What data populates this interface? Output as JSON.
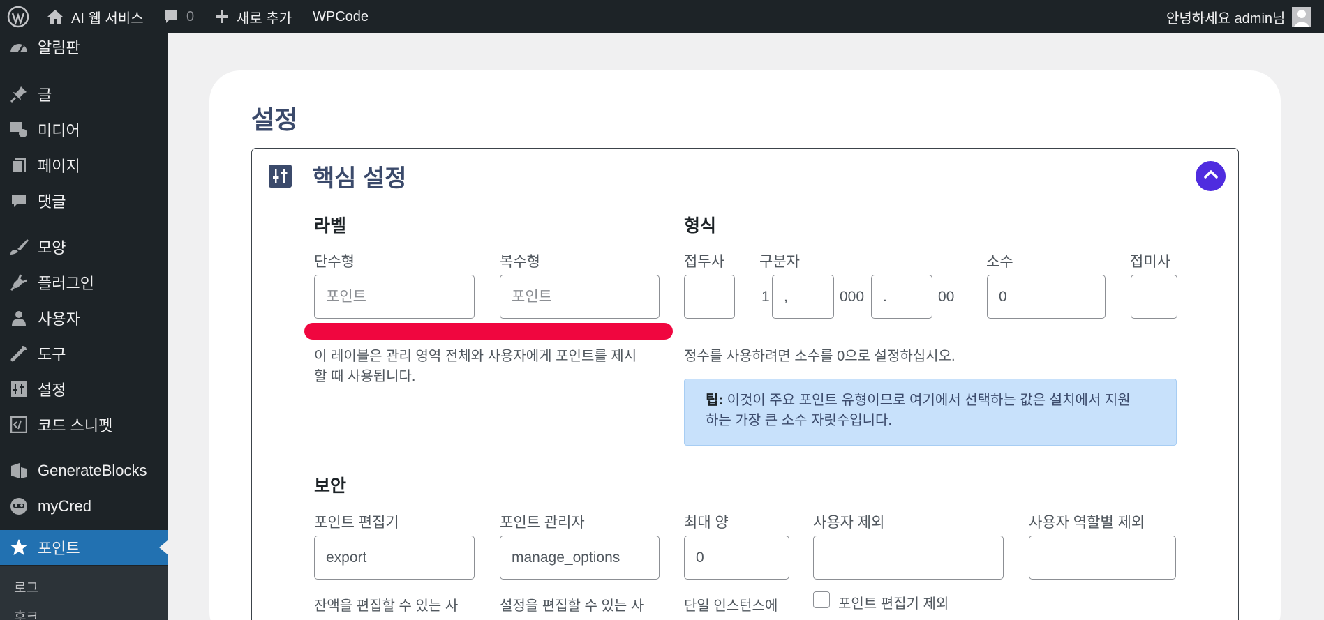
{
  "admin_bar": {
    "site_name": "AI 웹 서비스",
    "comments_count": "0",
    "new_label": "새로 추가",
    "plugin_link": "WPCode",
    "greeting": "안녕하세요 admin님"
  },
  "sidebar": {
    "items": [
      {
        "label": "알림판",
        "icon": "dashboard-icon"
      },
      {
        "label": "글",
        "icon": "pin-icon"
      },
      {
        "label": "미디어",
        "icon": "media-icon"
      },
      {
        "label": "페이지",
        "icon": "pages-icon"
      },
      {
        "label": "댓글",
        "icon": "comment-icon"
      },
      {
        "label": "모양",
        "icon": "brush-icon"
      },
      {
        "label": "플러그인",
        "icon": "plugin-icon"
      },
      {
        "label": "사용자",
        "icon": "user-icon"
      },
      {
        "label": "도구",
        "icon": "wrench-icon"
      },
      {
        "label": "설정",
        "icon": "settings-icon"
      },
      {
        "label": "코드 스니펫",
        "icon": "code-icon"
      },
      {
        "label": "GenerateBlocks",
        "icon": "generateblocks-icon"
      },
      {
        "label": "myCred",
        "icon": "mycred-icon"
      },
      {
        "label": "포인트",
        "icon": "star-icon"
      }
    ],
    "submenu": [
      "로그",
      "후크"
    ]
  },
  "page": {
    "title": "설정",
    "section_title": "핵심 설정"
  },
  "labels_section": {
    "heading": "라벨",
    "singular_label": "단수형",
    "singular_placeholder": "포인트",
    "plural_label": "복수형",
    "plural_placeholder": "포인트",
    "description_line1": "이 레이블은 관리 영역 전체와 사용자에게 포인트를 제시",
    "description_line2": "할 때 사용됩니다."
  },
  "format_section": {
    "heading": "형식",
    "prefix_label": "접두사",
    "prefix_value": "",
    "separator_label": "구분자",
    "num_one": "1",
    "thousands_sep": ",",
    "num_thousand": "000",
    "decimal_sep": ".",
    "num_decimals": "00",
    "decimals_label": "소수",
    "decimals_value": "0",
    "suffix_label": "접미사",
    "suffix_value": "",
    "hint": "정수를 사용하려면 소수를 0으로 설정하십시오.",
    "tip_label": "팁:",
    "tip_line1": "이것이 주요 포인트 유형이므로 여기에서 선택하는 값은 설치에서 지원",
    "tip_line2": "하는 가장 큰 소수 자릿수입니다."
  },
  "security_section": {
    "heading": "보안",
    "editor_label": "포인트 편집기",
    "editor_value": "export",
    "editor_desc": "잔액을 편집할 수 있는 사",
    "admin_label": "포인트 관리자",
    "admin_value": "manage_options",
    "admin_desc": "설정을 편집할 수 있는 사",
    "max_label": "최대 양",
    "max_value": "0",
    "max_desc": "단일 인스턴스에",
    "exclude_users_label": "사용자 제외",
    "exclude_users_value": "",
    "exclude_roles_label": "사용자 역할별 제외",
    "exclude_roles_value": "",
    "exclude_editor_checkbox": "포인트 편집기 제외"
  },
  "colors": {
    "admin_bar_bg": "#1d2327",
    "active_menu": "#2271b1",
    "accent": "#4f2cdf",
    "title_color": "#3b4a6b",
    "tip_bg": "#c8e1fb",
    "red_mark": "#f0063f"
  }
}
